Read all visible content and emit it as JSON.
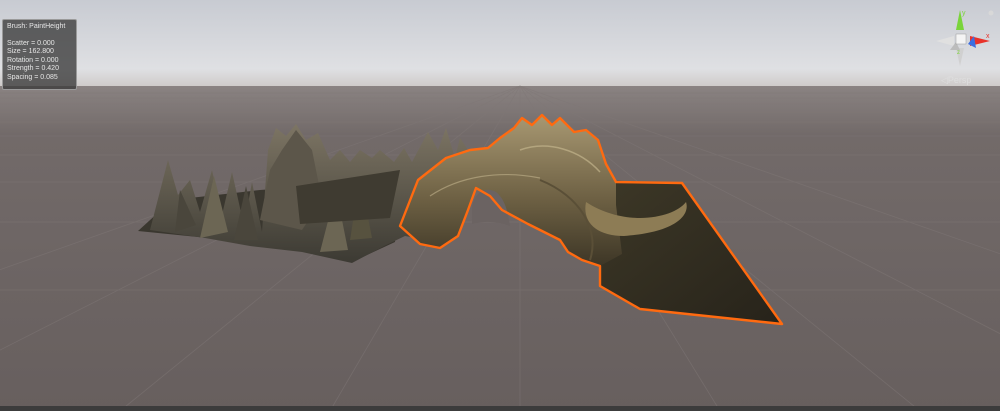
{
  "brush_panel": {
    "title": "Brush: PaintHeight",
    "rows": [
      "Scatter = 0.000",
      "Size = 162.800",
      "Rotation = 0.000",
      "Strength = 0.420",
      "Spacing = 0.085"
    ]
  },
  "scene_gizmo": {
    "projection_label": "◁Persp",
    "axes": [
      "x",
      "y",
      "z"
    ],
    "axis_colors": {
      "x": "#e8322a",
      "y": "#7ad43a",
      "z": "#3c6ee0"
    }
  },
  "viewport": {
    "sky_color": "#d3d5da",
    "ground_color": "#6b6362",
    "grid_color": "#7d7574",
    "selection_outline_color": "#ff6a10",
    "terrain_color": "#8c7c52"
  }
}
